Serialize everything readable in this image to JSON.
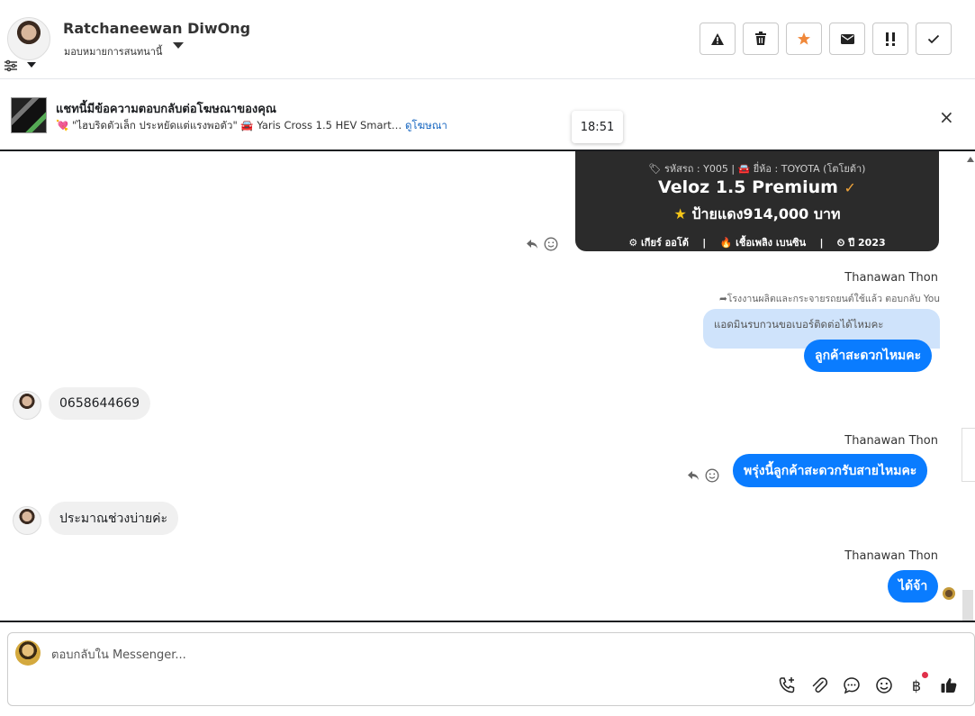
{
  "header": {
    "contact_name": "Ratchaneewan DiwOng",
    "assign_text": "มอบหมายการสนทนานี้",
    "toolbar": [
      {
        "name": "spam-button",
        "icon": "warning-icon"
      },
      {
        "name": "delete-button",
        "icon": "trash-icon"
      },
      {
        "name": "star-button",
        "icon": "star-icon",
        "color": "#f0883a"
      },
      {
        "name": "mark-unread-button",
        "icon": "envelope-icon"
      },
      {
        "name": "follow-up-button",
        "icon": "double-exclamation-icon"
      },
      {
        "name": "mark-done-button",
        "icon": "check-icon"
      }
    ]
  },
  "ad_banner": {
    "title": "แชทนี้มีข้อความตอบกลับต่อโฆษณาของคุณ",
    "subtitle": "💘 \"ไฮบริดตัวเล็ก ประหยัดแต่แรงพอตัว\" 🚘 Yaris Cross 1.5 HEV Smart…",
    "link": "ดูโฆษณา",
    "close": "×"
  },
  "chat": {
    "time": "18:51",
    "car_card": {
      "meta": "🏷 รหัสรถ : Y005 | 🚘 ยี่ห้อ : TOYOTA (โตโยต้า)",
      "model": "Veloz 1.5 Premium",
      "check": "✓",
      "price_star": "★",
      "price": "ป้ายแดง914,000 บาท",
      "specs": "⚙ เกียร์ ออโต้    |    🔥 เชื้อเพลิง เบนซิน    |    ⏲ ปี 2023"
    },
    "messages": [
      {
        "sender": "Thanawan Thon",
        "reply_meta": "➦โรงงานผลิตและกระจายรถยนต์ใช้แล้ว ตอบกลับ You",
        "quoted": "แอดมินรบกวนขอเบอร์ติดต่อได้ไหมคะ",
        "text": "ลูกค้าสะดวกไหมคะ"
      },
      {
        "incoming": true,
        "text": "0658644669"
      },
      {
        "sender": "Thanawan Thon",
        "text": "พรุ่งนี้ลูกค้าสะดวกรับสายไหมคะ"
      },
      {
        "incoming": true,
        "text": "ประมาณช่วงบ่ายค่ะ"
      },
      {
        "sender": "Thanawan Thon",
        "text": "ได้จ้า"
      }
    ]
  },
  "composer": {
    "placeholder": "ตอบกลับใน Messenger...",
    "icons": [
      "call-add-icon",
      "paperclip-icon",
      "chat-bubble-icon",
      "emoji-icon",
      "baht-icon",
      "thumbs-up-icon"
    ],
    "baht_symbol": "฿"
  },
  "colors": {
    "outgoing_bubble": "#0a7cff",
    "incoming_bubble": "#f0f0f0",
    "quoted_bubble": "#cfe3fb",
    "car_card": "#2b2b2b"
  }
}
